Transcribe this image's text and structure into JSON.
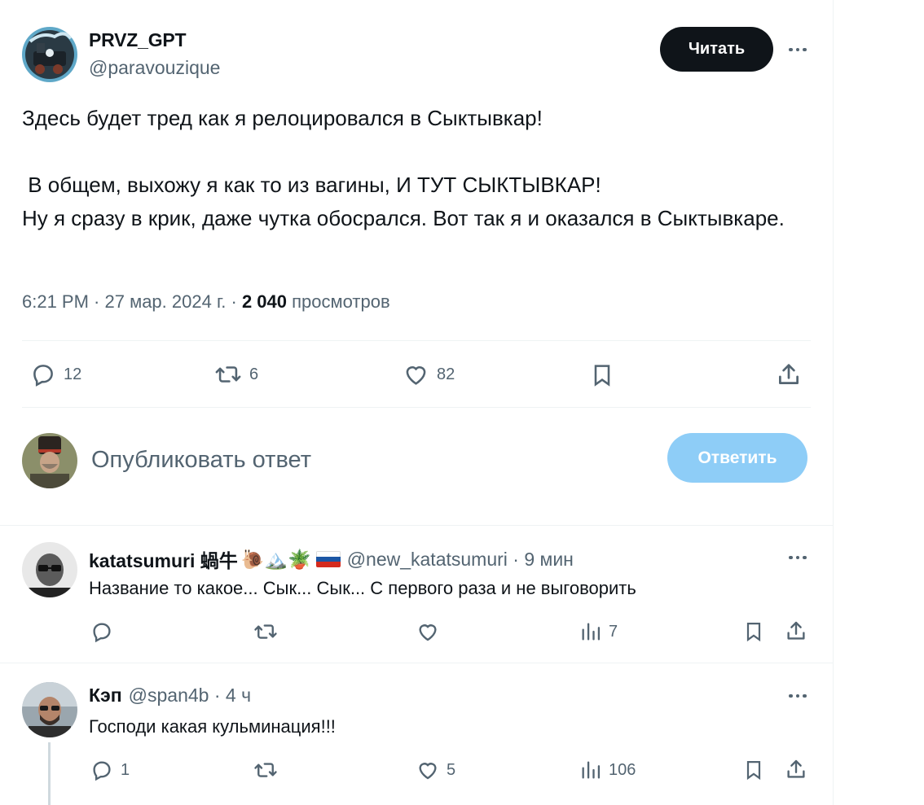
{
  "tweet": {
    "author_name": "PRVZ_GPT",
    "author_handle": "@paravouzique",
    "follow_label": "Читать",
    "text": "Здесь будет тред как я релоцировался в Сыктывкар!\n\n В общем, выхожу я как то из вагины, И ТУТ СЫКТЫВКАР!\nНу я сразу в крик, даже чутка обосрался. Вот так я и оказался в Сыктывкаре.",
    "time": "6:21 PM · 27 мар. 2024 г. · ",
    "views_count": "2 040",
    "views_label": "просмотров",
    "stats": {
      "replies": "12",
      "retweets": "6",
      "likes": "82"
    },
    "icons": [
      "reply-icon",
      "retweet-icon",
      "like-icon",
      "bookmark-icon",
      "share-icon",
      "more-icon"
    ]
  },
  "composer": {
    "placeholder": "Опубликовать ответ",
    "reply_label": "Ответить"
  },
  "replies": [
    {
      "name": "katatsumuri 蝸牛",
      "emoji": "🐌🏔️🪴",
      "handle": "@new_katatsumuri · 9 мин",
      "text": "Название то какое... Сык... Сык... С первого раза и не выговорить",
      "views": "7"
    },
    {
      "name": "Кэп",
      "handle": "@span4b · 4 ч",
      "text": "Господи какая кульминация!!!",
      "replies": "1",
      "likes": "5",
      "views": "106"
    }
  ],
  "colors": {
    "text": "#0f1419",
    "secondary": "#536471",
    "reply_button_disabled": "#8ecdf7",
    "follow_button": "#0f1419",
    "divider": "#eff3f4"
  }
}
